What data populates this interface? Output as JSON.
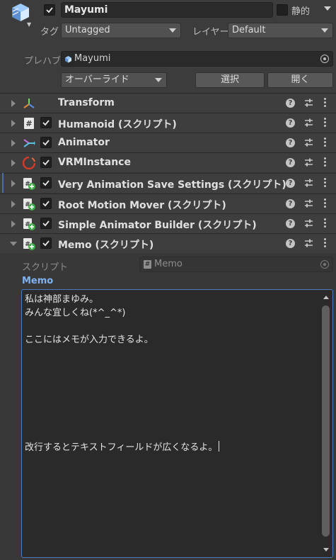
{
  "header": {
    "object_name": "Mayumi",
    "active_checked": true,
    "static_label": "静的",
    "tag_label": "タグ",
    "tag_value": "Untagged",
    "layer_label": "レイヤー",
    "layer_value": "Default",
    "prefab_label": "プレハブ",
    "prefab_value": "Mayumi",
    "overrides_label": "オーバーライド",
    "select_label": "選択",
    "open_label": "開く"
  },
  "components": [
    {
      "name": "Transform",
      "icon": "transform-icon",
      "has_checkbox": false
    },
    {
      "name": "Humanoid (スクリプト)",
      "icon": "script-icon",
      "has_checkbox": true
    },
    {
      "name": "Animator",
      "icon": "animator-icon",
      "has_checkbox": true
    },
    {
      "name": "VRMInstance",
      "icon": "vrm-icon",
      "has_checkbox": true
    },
    {
      "name": "Very Animation Save Settings (スクリプト)",
      "icon": "cs-script-icon",
      "has_checkbox": true
    },
    {
      "name": "Root Motion Mover (スクリプト)",
      "icon": "cs-script-icon",
      "has_checkbox": true
    },
    {
      "name": "Simple Animator Builder (スクリプト)",
      "icon": "cs-script-icon",
      "has_checkbox": true
    },
    {
      "name": "Memo (スクリプト)",
      "icon": "cs-script-icon",
      "has_checkbox": true,
      "expanded": true
    }
  ],
  "memo": {
    "script_label": "スクリプト",
    "script_value": "Memo",
    "field_label": "Memo",
    "text": "私は神部まゆみ。\nみんな宜しくね(*^_^*)\n\nここにはメモが入力できるよ。\n\n\n\n\n\n\n\n改行するとテキストフィールドが広くなるよ。"
  },
  "colors": {
    "accent": "#4a7bbf",
    "label_blue": "#7fb3f0",
    "panel": "#383838"
  }
}
